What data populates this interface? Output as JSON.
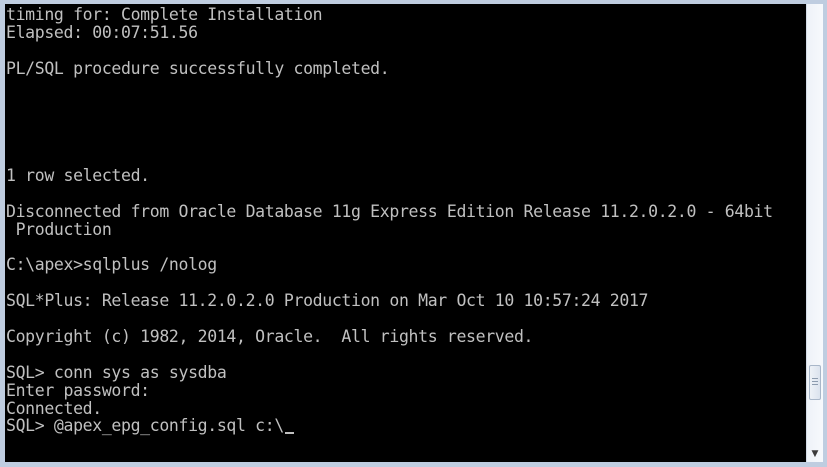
{
  "terminal": {
    "lines": [
      "timing for: Complete Installation",
      "Elapsed: 00:07:51.56",
      "",
      "PL/SQL procedure successfully completed.",
      "",
      "",
      "",
      "",
      "",
      "1 row selected.",
      "",
      "Disconnected from Oracle Database 11g Express Edition Release 11.2.0.2.0 - 64bit",
      " Production",
      "",
      "C:\\apex>sqlplus /nolog",
      "",
      "SQL*Plus: Release 11.2.0.2.0 Production on Mar Oct 10 10:57:24 2017",
      "",
      "Copyright (c) 1982, 2014, Oracle.  All rights reserved.",
      "",
      "SQL> conn sys as sysdba",
      "Enter password:",
      "Connected.",
      "SQL> @apex_epg_config.sql c:\\"
    ]
  },
  "colors": {
    "console_background": "#000000",
    "console_text": "#c0c0c0",
    "window_frame": "#bfcde0",
    "scrollbar_background": "#e9eef6"
  },
  "scroll": {
    "position_fraction": 0.89,
    "icons": {
      "down_arrow": "chevron-down-icon"
    }
  }
}
